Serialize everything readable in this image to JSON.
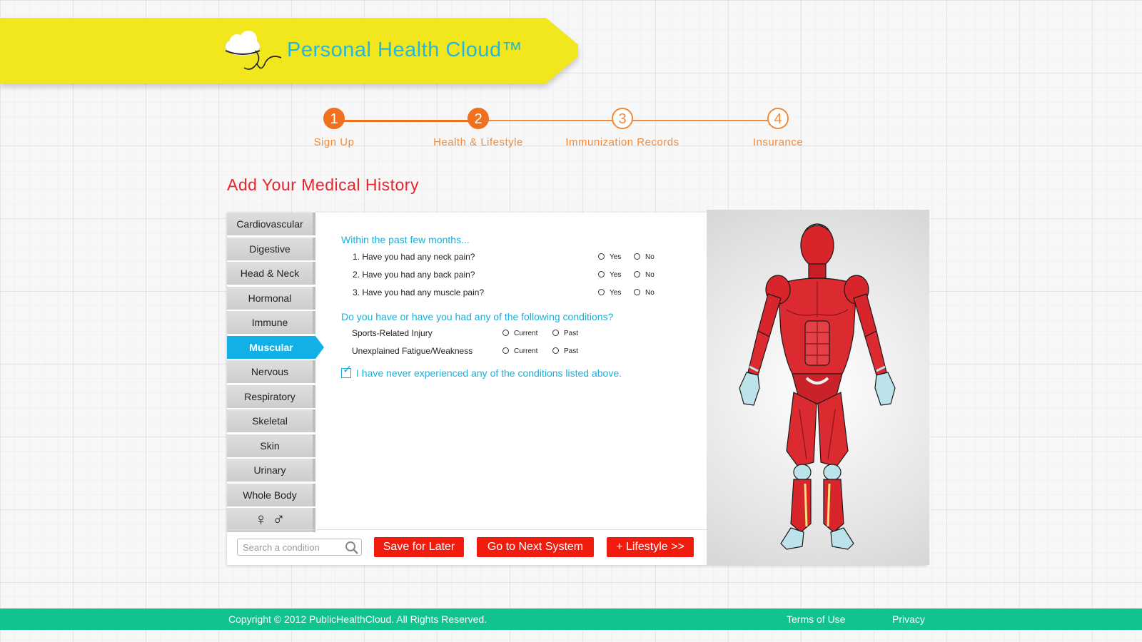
{
  "header": {
    "logo_text": "Personal Health Cloud™"
  },
  "steps": [
    {
      "number": "1",
      "label": "Sign Up",
      "done": true
    },
    {
      "number": "2",
      "label": "Health & Lifestyle",
      "done": true
    },
    {
      "number": "3",
      "label": "Immunization Records",
      "done": false
    },
    {
      "number": "4",
      "label": "Insurance",
      "done": false
    }
  ],
  "page_title": "Add Your Medical History",
  "systems_nav": {
    "items": [
      "Cardiovascular",
      "Digestive",
      "Head & Neck",
      "Hormonal",
      "Immune",
      "Muscular",
      "Nervous",
      "Respiratory",
      "Skeletal",
      "Skin",
      "Urinary",
      "Whole Body"
    ],
    "active": "Muscular",
    "gender_symbols": "♀ ♂"
  },
  "questions": {
    "heading": "Within the past few months...",
    "items": [
      {
        "text": "1. Have you had any neck pain?",
        "yes": "Yes",
        "no": "No"
      },
      {
        "text": "2. Have you had any back pain?",
        "yes": "Yes",
        "no": "No"
      },
      {
        "text": "3. Have you had any muscle pain?",
        "yes": "Yes",
        "no": "No"
      }
    ]
  },
  "conditions": {
    "heading": "Do you have or have you had any of the following conditions?",
    "items": [
      {
        "text": "Sports-Related Injury",
        "current": "Current",
        "past": "Past"
      },
      {
        "text": "Unexplained Fatigue/Weakness",
        "current": "Current",
        "past": "Past"
      }
    ],
    "never_label": "I have never experienced any of the conditions listed above.",
    "never_checked": true
  },
  "search": {
    "placeholder": "Search a condition"
  },
  "buttons": {
    "save": "Save for Later",
    "next_system": "Go to Next System",
    "lifestyle": "+ Lifestyle >>"
  },
  "footer": {
    "copyright": "Copyright © 2012 PublicHealthCloud. All Rights Reserved.",
    "terms": "Terms of Use",
    "privacy": "Privacy"
  },
  "colors": {
    "banner": "#f2e61d",
    "accent_blue": "#1aaed9",
    "step_orange": "#f0701f",
    "title_red": "#e8252d",
    "button_red": "#f21c0e",
    "footer_green": "#10c38f"
  }
}
